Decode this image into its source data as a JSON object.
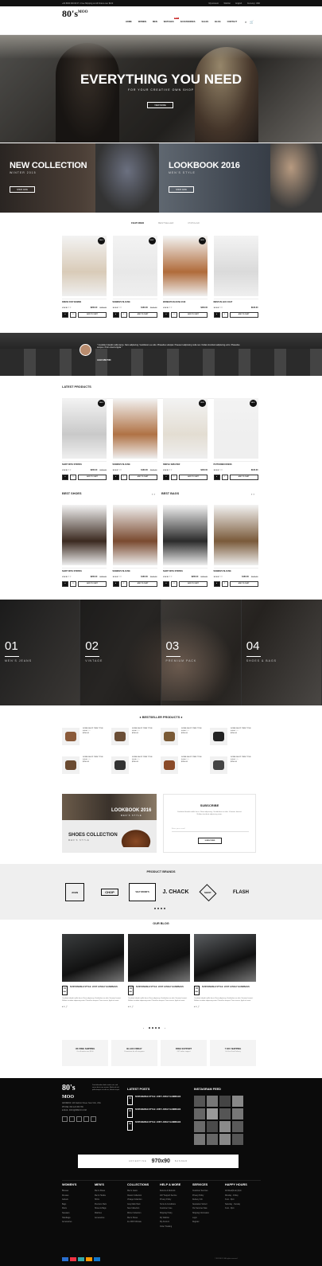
{
  "topbar": {
    "left": "+00 8000 000 00 07 • Free Shipping on All Orders over $100",
    "account": "My Account",
    "wishlist": "Wishlist",
    "lang": "English",
    "currency": "Currency: USD"
  },
  "logo": {
    "main": "80's",
    "sub": "MOO"
  },
  "nav": [
    "HOME",
    "WOMEN",
    "MEN",
    "WATCHES",
    "ACCESSORIES",
    "SALES",
    "BLOG",
    "CONTACT"
  ],
  "nav_badge": "HOT",
  "hero": {
    "title": "EVERYTHING YOU NEED",
    "subtitle": "FOR YOUR CREATIVE OWN SHOP",
    "button": "VIEW MORE"
  },
  "banners": [
    {
      "title": "NEW COLLECTION",
      "sub": "WINTER 2015",
      "button": "SHOP NOW"
    },
    {
      "title": "LOOKBOOK 2016",
      "sub": "MEN'S STYLE",
      "button": "SHOP NOW"
    }
  ],
  "tabs": [
    "FEATURED",
    "BESTSELLER",
    "POPULAR"
  ],
  "featured": [
    {
      "name": "DRESS FOR WOMEN",
      "price": "$260.00",
      "old": "$280.00",
      "tag": "SALE",
      "color": "#d9cbb8"
    },
    {
      "name": "WOMEN'S BLOUSE",
      "price": "$160.00",
      "old": "$180.00",
      "tag": "NEW",
      "color": "#e8e8e8"
    },
    {
      "name": "WOMEN'S BLOUSE 2018",
      "price": "$300.00",
      "old": "",
      "tag": "NEW",
      "color": "#b06b3a"
    },
    {
      "name": "MEN'S BLACK COAT",
      "price": "$180.00",
      "old": "",
      "tag": "",
      "color": "#dadada"
    }
  ],
  "actions": {
    "add": "ADD TO CART"
  },
  "testimonial": {
    "quote": "\" Curabitur blandit mollis lacus. Nam adipiscing. Vestibulum eu odio. Phasellus volutpat. Praesent adipiscing nulla nec. Nullam tincidunt adipiscing enim. Phasellus tempus. Proin viverra ligula \"",
    "author": "ALEX MILTON"
  },
  "latest": {
    "title": "LATEST PRODUCTS",
    "items": [
      {
        "name": "SHIRT WITH STRIPES",
        "price": "$260.00",
        "old": "$280.00",
        "tag": "SALE",
        "color": "#c9c9c9"
      },
      {
        "name": "WOMEN'S BLOUSE",
        "price": "$160.00",
        "old": "$180.00",
        "tag": "",
        "color": "#b07245"
      },
      {
        "name": "SIMPLE SWEATER",
        "price": "$200.00",
        "old": "",
        "tag": "NEW",
        "color": "#e3ddd2"
      },
      {
        "name": "PATTERNED DRESS",
        "price": "$180.00",
        "old": "",
        "tag": "SALE",
        "color": "#efefef"
      }
    ]
  },
  "shoes": {
    "title": "BEST SHOES",
    "items": [
      {
        "name": "SHIRT WITH STRIPES",
        "price": "$260.00",
        "old": "$280.00",
        "color": "#3b2a20"
      },
      {
        "name": "WOMEN'S BLOUSE",
        "price": "$160.00",
        "old": "$180.00",
        "color": "#7a4a30"
      }
    ]
  },
  "bags": {
    "title": "BEST BAGS",
    "items": [
      {
        "name": "SHIRT WITH STRIPES",
        "price": "$260.00",
        "old": "$280.00",
        "color": "#2b2b2b"
      },
      {
        "name": "WOMEN'S BLOUSE",
        "price": "$160.00",
        "old": "$180.00",
        "color": "#7a5a3a"
      }
    ]
  },
  "collections": [
    {
      "num": "01",
      "label": "MEN'S JEANS"
    },
    {
      "num": "02",
      "label": "VINTAGE"
    },
    {
      "num": "03",
      "label": "PREMIUM PACK"
    },
    {
      "num": "04",
      "label": "SHOES & BAGS"
    }
  ],
  "bestseller": {
    "title": "BESTSELLER PRODUCTS",
    "items": [
      {
        "name": "SOME SHOP ITEM TITLE",
        "price": "$250.00",
        "color": "#8a5a3a"
      },
      {
        "name": "SOME SHOP ITEM TITLE",
        "price": "$250.00",
        "color": "#6b4e36"
      },
      {
        "name": "SOME SHOP ITEM TITLE",
        "price": "$250.00",
        "color": "#7a5a36"
      },
      {
        "name": "SOME SHOP ITEM TITLE",
        "price": "$250.00",
        "color": "#222"
      },
      {
        "name": "SOME SHOP ITEM TITLE",
        "price": "$250.00",
        "color": "#6a4a30"
      },
      {
        "name": "SOME SHOP ITEM TITLE",
        "price": "$250.00",
        "color": "#333"
      },
      {
        "name": "SOME SHOP ITEM TITLE",
        "price": "$250.00",
        "color": "#8a4a28"
      },
      {
        "name": "SOME SHOP ITEM TITLE",
        "price": "$250.00",
        "color": "#444"
      }
    ]
  },
  "lookbook": {
    "title": "LOOKBOOK 2016",
    "sub": "MEN'S STYLE",
    "shoes": "SHOES COLLECTION",
    "shoes_sub": "MEN'S STYLE"
  },
  "subscribe": {
    "title": "SUBSCRIBE",
    "text": "Curabitur blandit mollis lacus. Nam adipiscing. Vestibulum eu odio. Vivamus laoreet. Nullam tincidunt adipiscing enim.",
    "placeholder": "Enter your e-mail",
    "button": "SUBSCRIBE"
  },
  "brands": {
    "title": "PRODUCT BRANDS",
    "items": [
      "JOHN",
      "CHOP",
      "SHOP",
      "VELT WOOD'S",
      "J. CHACK",
      "SHOP",
      "FLASH"
    ]
  },
  "blog": {
    "title": "OUR BLOG",
    "posts": [
      {
        "day": "04",
        "mon": "MAY",
        "title": "SUSTAINABLE STYLE: JUST LOVELY HANDBAGS",
        "excerpt": "Curabitur blandit mollis lacus. Nam adipiscing. Vestibulum eu odio. Vivamus laoreet. Nullam tincidunt adipiscing enim. Phasellus tempus. Proin viverra, ligula sit amet.",
        "color": "#3a3d3e"
      },
      {
        "day": "04",
        "mon": "MAY",
        "title": "SUSTAINABLE STYLE: JUST LOVELY HANDBAGS",
        "excerpt": "Curabitur blandit mollis lacus. Nam adipiscing. Vestibulum eu odio. Vivamus laoreet. Nullam tincidunt adipiscing enim. Phasellus tempus. Proin viverra, ligula sit amet.",
        "color": "#2b2b2b"
      },
      {
        "day": "04",
        "mon": "MAY",
        "title": "SUSTAINABLE STYLE: JUST LOVELY HANDBAGS",
        "excerpt": "Curabitur blandit mollis lacus. Nam adipiscing. Vestibulum eu odio. Vivamus laoreet. Nullam tincidunt adipiscing enim. Phasellus tempus. Proin viverra, ligula sit amet.",
        "color": "#5a5d60"
      }
    ]
  },
  "services": [
    {
      "t": "UK FREE SHIPPING",
      "s": "On all orders over $100"
    },
    {
      "t": "BLACK FRIDAY",
      "s": "Promotions for all categories"
    },
    {
      "t": "FREE SUPPORT",
      "s": "24/7 online support"
    },
    {
      "t": "7 DAY SHIPPING",
      "s": "On Free Fast Delivery"
    }
  ],
  "footer": {
    "about": "Duis bibendum dolor mattis nisi, sed varius dui in nec ornare. Morbi vel nisl, pellentesque et nulla ac, lobortis turpis.",
    "address": "ADDRESS: 123 Fashion Street, New York, USA",
    "phone": "PHONE: 800 123 456 789",
    "email": "E-MAIL: INFO@80MOO.COM",
    "latest_title": "LATEST POSTS",
    "posts": [
      "SUSTAINABLE STYLE: JUST LOVELY HANDBAGS",
      "SUSTAINABLE STYLE: JUST LOVELY HANDBAGS",
      "SUSTAINABLE STYLE: JUST LOVELY HANDBAGS"
    ],
    "insta_title": "INSTAGRAM FEED",
    "ad_left": "ADVERTISE",
    "ad_size": "970x90",
    "ad_right": "BANNER",
    "cols": [
      {
        "t": "WOMEN'S",
        "items": [
          "Blouses",
          "Dresses",
          "Jackets",
          "Bags",
          "Pants",
          "Sweaters",
          "Handbags",
          "Accessories"
        ]
      },
      {
        "t": "MEN'S",
        "items": [
          "Men's Shoes",
          "Men's Hoodie",
          "Shirts",
          "Premium Pack",
          "Shoes & Bags",
          "Watches",
          "Accessories"
        ]
      },
      {
        "t": "COLLECTIONS",
        "items": [
          "Men's Jeans",
          "Classic Collection",
          "Vintage Collection",
          "Gray Mark Pack",
          "New Collection",
          "Winter Collection",
          "Men's Shoes",
          "Ice 2015 Ultimate"
        ]
      },
      {
        "t": "HELP & MORE",
        "items": [
          "Returns & Refunds",
          "24/7 Support Service",
          "Privacy Policy",
          "Terms & Conditions",
          "Customer Care",
          "Shipping Policy",
          "My Wishlist",
          "My Account",
          "Order Tracking"
        ]
      },
      {
        "t": "SERVICES",
        "items": [
          "Customer Services",
          "Privacy Policy",
          "Delivery Info",
          "Newsletter Subscr",
          "Our Services Sale",
          "Shipping Information",
          "Login",
          "Register"
        ]
      },
      {
        "t": "HAPPY HOURS",
        "items": [
          "All Week(9 am) 9pm",
          "Monday - Friday",
          "9 am - 8pm",
          "Saturday - Sunday",
          "9 am - 8pm"
        ]
      }
    ],
    "copyright": "© 80'S MOO. All rights reserved."
  }
}
